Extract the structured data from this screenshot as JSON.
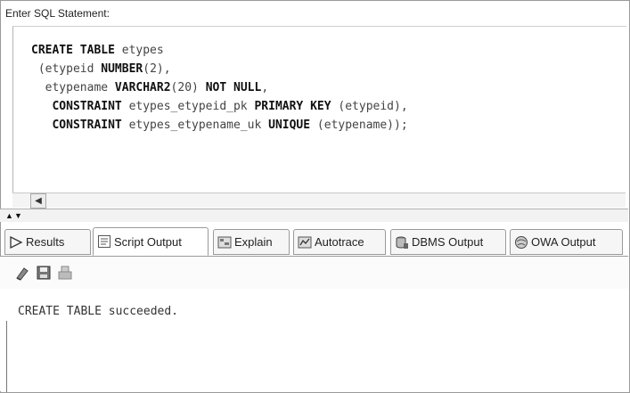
{
  "prompt_label": "Enter SQL Statement:",
  "sql": {
    "lines": [
      [
        {
          "t": "CREATE TABLE",
          "kw": true
        },
        {
          "t": " etypes",
          "kw": false
        }
      ],
      [
        {
          "t": " (etypeid ",
          "kw": false
        },
        {
          "t": "NUMBER",
          "kw": true
        },
        {
          "t": "(2),",
          "kw": false
        }
      ],
      [
        {
          "t": "  etypename ",
          "kw": false
        },
        {
          "t": "VARCHAR2",
          "kw": true
        },
        {
          "t": "(20) ",
          "kw": false
        },
        {
          "t": "NOT NULL",
          "kw": true
        },
        {
          "t": ",",
          "kw": false
        }
      ],
      [
        {
          "t": "   CONSTRAINT",
          "kw": true
        },
        {
          "t": " etypes_etypeid_pk ",
          "kw": false
        },
        {
          "t": "PRIMARY KEY",
          "kw": true
        },
        {
          "t": " (etypeid),",
          "kw": false
        }
      ],
      [
        {
          "t": "   CONSTRAINT",
          "kw": true
        },
        {
          "t": " etypes_etypename_uk ",
          "kw": false
        },
        {
          "t": "UNIQUE",
          "kw": true
        },
        {
          "t": " (etypename));",
          "kw": false
        }
      ]
    ]
  },
  "tabs": [
    {
      "label": "Results",
      "icon": "play-triangle-icon"
    },
    {
      "label": "Script Output",
      "icon": "script-document-icon"
    },
    {
      "label": "Explain",
      "icon": "explain-plan-icon"
    },
    {
      "label": "Autotrace",
      "icon": "autotrace-icon"
    },
    {
      "label": "DBMS Output",
      "icon": "dbms-output-icon"
    },
    {
      "label": "OWA Output",
      "icon": "owa-globe-icon"
    }
  ],
  "active_tab": "Script Output",
  "toolbar": {
    "clear_icon": "eraser-icon",
    "save_icon": "save-disk-icon",
    "print_icon": "print-icon"
  },
  "output_text": "CREATE TABLE succeeded."
}
